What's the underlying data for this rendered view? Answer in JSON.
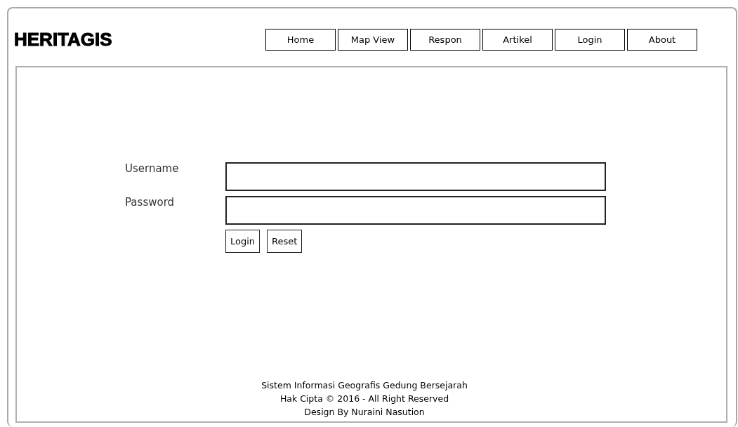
{
  "site_title": "HERITAGIS",
  "nav": [
    {
      "label": "Home"
    },
    {
      "label": "Map View"
    },
    {
      "label": "Respon"
    },
    {
      "label": "Artikel"
    },
    {
      "label": "Login"
    },
    {
      "label": "About"
    }
  ],
  "login_form": {
    "fields": [
      {
        "label": "Username"
      },
      {
        "label": "Password"
      }
    ],
    "buttons": [
      "Login",
      "Reset"
    ]
  },
  "footer": [
    "Sistem Informasi Geografis Gedung Bersejarah",
    "Hak Cipta © 2016 - All Right Reserved",
    "Design By Nuraini Nasution"
  ]
}
